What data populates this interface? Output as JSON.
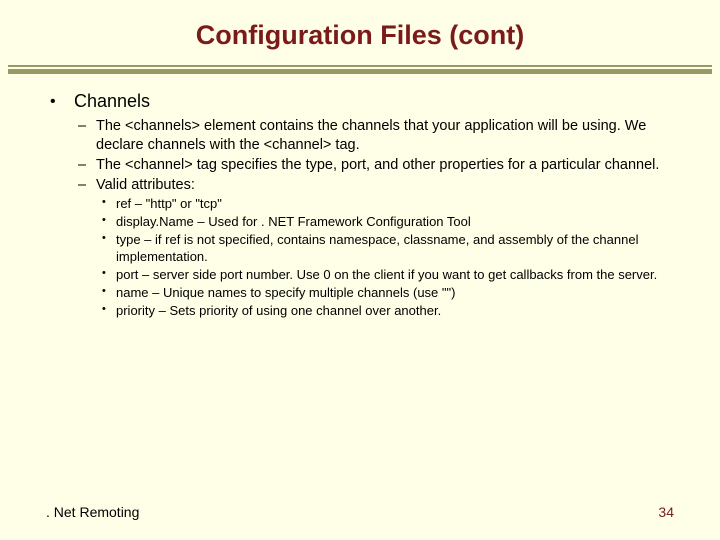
{
  "title": "Configuration Files (cont)",
  "section_heading": "Channels",
  "bullets_level2": [
    "The <channels> element contains the channels that your application will be using. We declare channels with the <channel> tag.",
    "The <channel> tag specifies the type, port, and other properties for a particular channel.",
    "Valid attributes:"
  ],
  "bullets_level3": [
    "ref – \"http\" or \"tcp\"",
    "display.Name – Used for . NET Framework Configuration Tool",
    "type – if ref is not specified, contains namespace, classname, and assembly of the channel implementation.",
    "port – server side port number. Use 0 on the client if you want to get callbacks from the server.",
    "name – Unique names to specify multiple channels (use \"\")",
    "priority – Sets priority of using one channel over another."
  ],
  "footer_left": ". Net Remoting",
  "footer_right": "34"
}
